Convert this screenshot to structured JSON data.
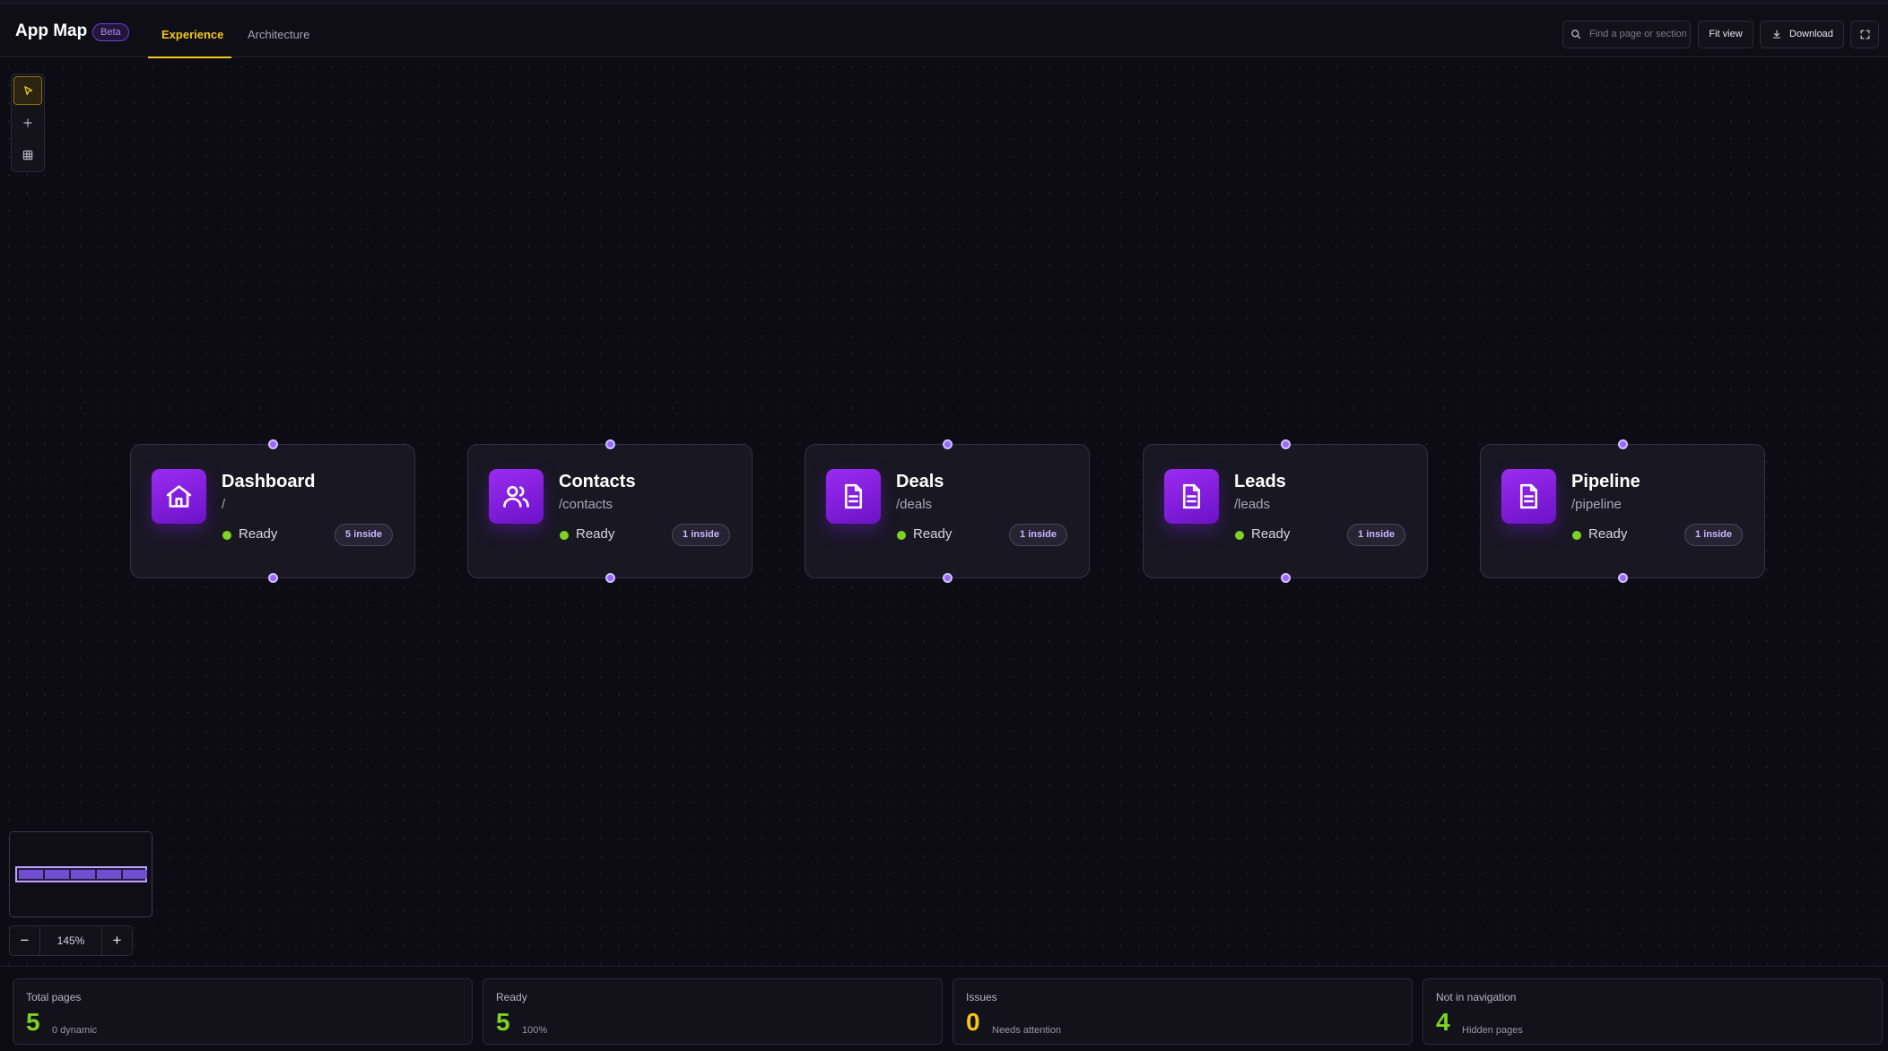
{
  "header": {
    "brand": "App Map",
    "badge": "Beta",
    "tabs": [
      {
        "label": "Experience",
        "active": true
      },
      {
        "label": "Architecture",
        "active": false
      }
    ],
    "search_placeholder": "Find a page or section",
    "fit_label": "Fit view",
    "download_label": "Download"
  },
  "toolbar": {
    "tools": [
      "select-pointer-icon",
      "add-plus-icon",
      "grid-icon"
    ]
  },
  "pages": [
    {
      "title": "Dashboard",
      "path": "/",
      "status": "Ready",
      "inside": "5 inside",
      "icon": "home-icon"
    },
    {
      "title": "Contacts",
      "path": "/contacts",
      "status": "Ready",
      "inside": "1 inside",
      "icon": "users-icon"
    },
    {
      "title": "Deals",
      "path": "/deals",
      "status": "Ready",
      "inside": "1 inside",
      "icon": "document-icon"
    },
    {
      "title": "Leads",
      "path": "/leads",
      "status": "Ready",
      "inside": "1 inside",
      "icon": "document-icon"
    },
    {
      "title": "Pipeline",
      "path": "/pipeline",
      "status": "Ready",
      "inside": "1 inside",
      "icon": "document-icon"
    }
  ],
  "zoom": {
    "value": "145%",
    "minus": "−",
    "plus": "+"
  },
  "stats": [
    {
      "label": "Total pages",
      "value": "5",
      "sub": "0 dynamic",
      "color": "#7ed321"
    },
    {
      "label": "Ready",
      "value": "5",
      "sub": "100%",
      "color": "#7ed321"
    },
    {
      "label": "Issues",
      "value": "0",
      "sub": "Needs attention",
      "color": "#f5c518"
    },
    {
      "label": "Not in navigation",
      "value": "4",
      "sub": "Hidden pages",
      "color": "#7ed321"
    }
  ],
  "colors": {
    "accent_yellow": "#f2c81d",
    "accent_purple": "#8b2be2",
    "status_green": "#7ed321"
  }
}
